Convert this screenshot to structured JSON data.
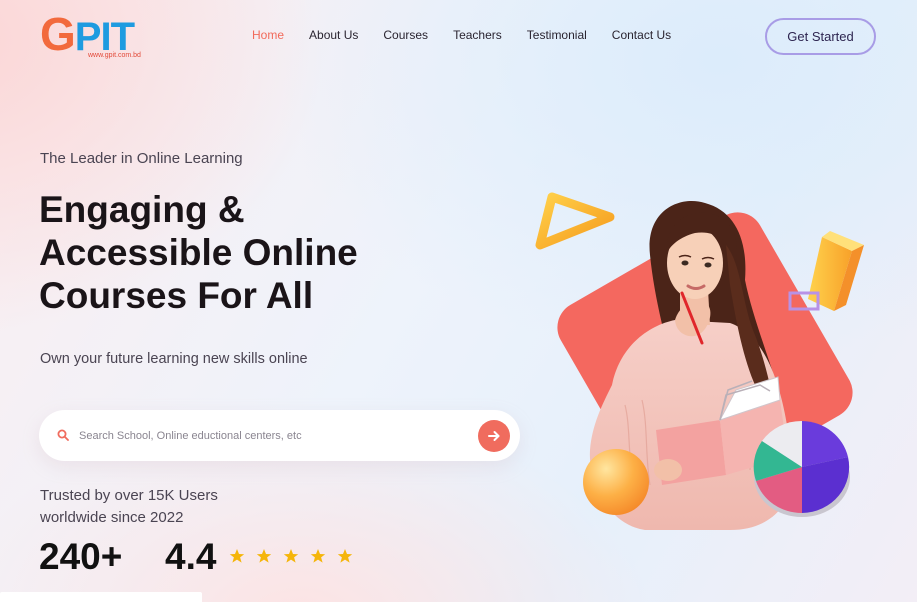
{
  "brand": {
    "logo_g": "G",
    "logo_pit": "PIT",
    "logo_url": "www.gpit.com.bd"
  },
  "nav": {
    "items": [
      {
        "label": "Home",
        "active": true
      },
      {
        "label": "About Us",
        "active": false
      },
      {
        "label": "Courses",
        "active": false
      },
      {
        "label": "Teachers",
        "active": false
      },
      {
        "label": "Testimonial",
        "active": false
      },
      {
        "label": "Contact Us",
        "active": false
      }
    ],
    "cta_label": "Get Started"
  },
  "hero": {
    "tagline": "The Leader in Online Learning",
    "headline_line1": "Engaging &",
    "headline_line2": "Accessible Online",
    "headline_line3": "Courses For All",
    "subtitle": "Own your future learning new skills online",
    "search_placeholder": "Search School, Online eductional centers, etc",
    "trusted_line1": "Trusted by over 15K Users",
    "trusted_line2": "worldwide since 2022",
    "stat_users": "240+",
    "stat_rating": "4.4",
    "rating_stars": 5
  },
  "colors": {
    "accent": "#f06c5e",
    "nav_active": "#f26a5a",
    "cta_border": "#a89ce6",
    "star": "#f5b50a",
    "brand_orange": "#f26a3d",
    "brand_blue": "#1e9be0"
  },
  "icons": {
    "search": "search-icon",
    "arrow": "arrow-right-icon",
    "star": "star-icon"
  }
}
